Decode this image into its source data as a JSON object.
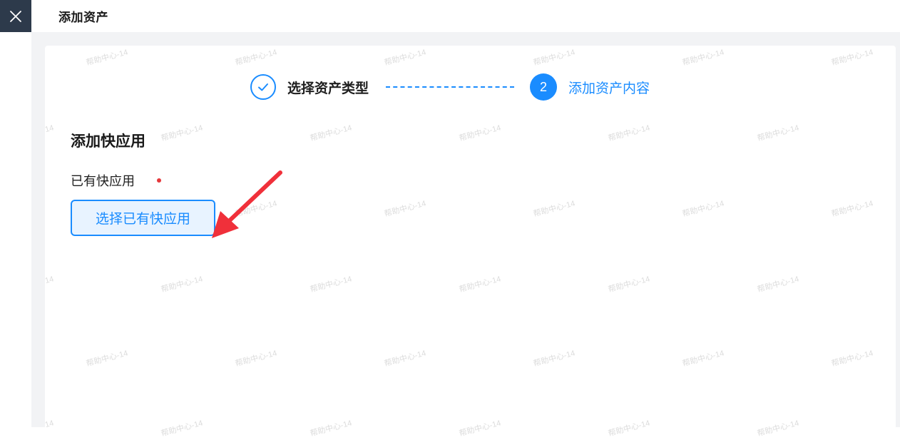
{
  "header": {
    "title": "添加资产"
  },
  "steps": [
    {
      "label": "选择资产类型",
      "status": "done"
    },
    {
      "label": "添加资产内容",
      "number": "2",
      "status": "active"
    }
  ],
  "section": {
    "title": "添加快应用",
    "field_label": "已有快应用",
    "button_label": "选择已有快应用"
  },
  "watermark_text": "帮助中心-14",
  "colors": {
    "accent": "#1a8cff",
    "sidebar": "#2d3a4b",
    "required": "#e5383b",
    "annotation_arrow": "#f0303a"
  },
  "icons": {
    "close": "close-icon",
    "step_done": "check-icon"
  }
}
